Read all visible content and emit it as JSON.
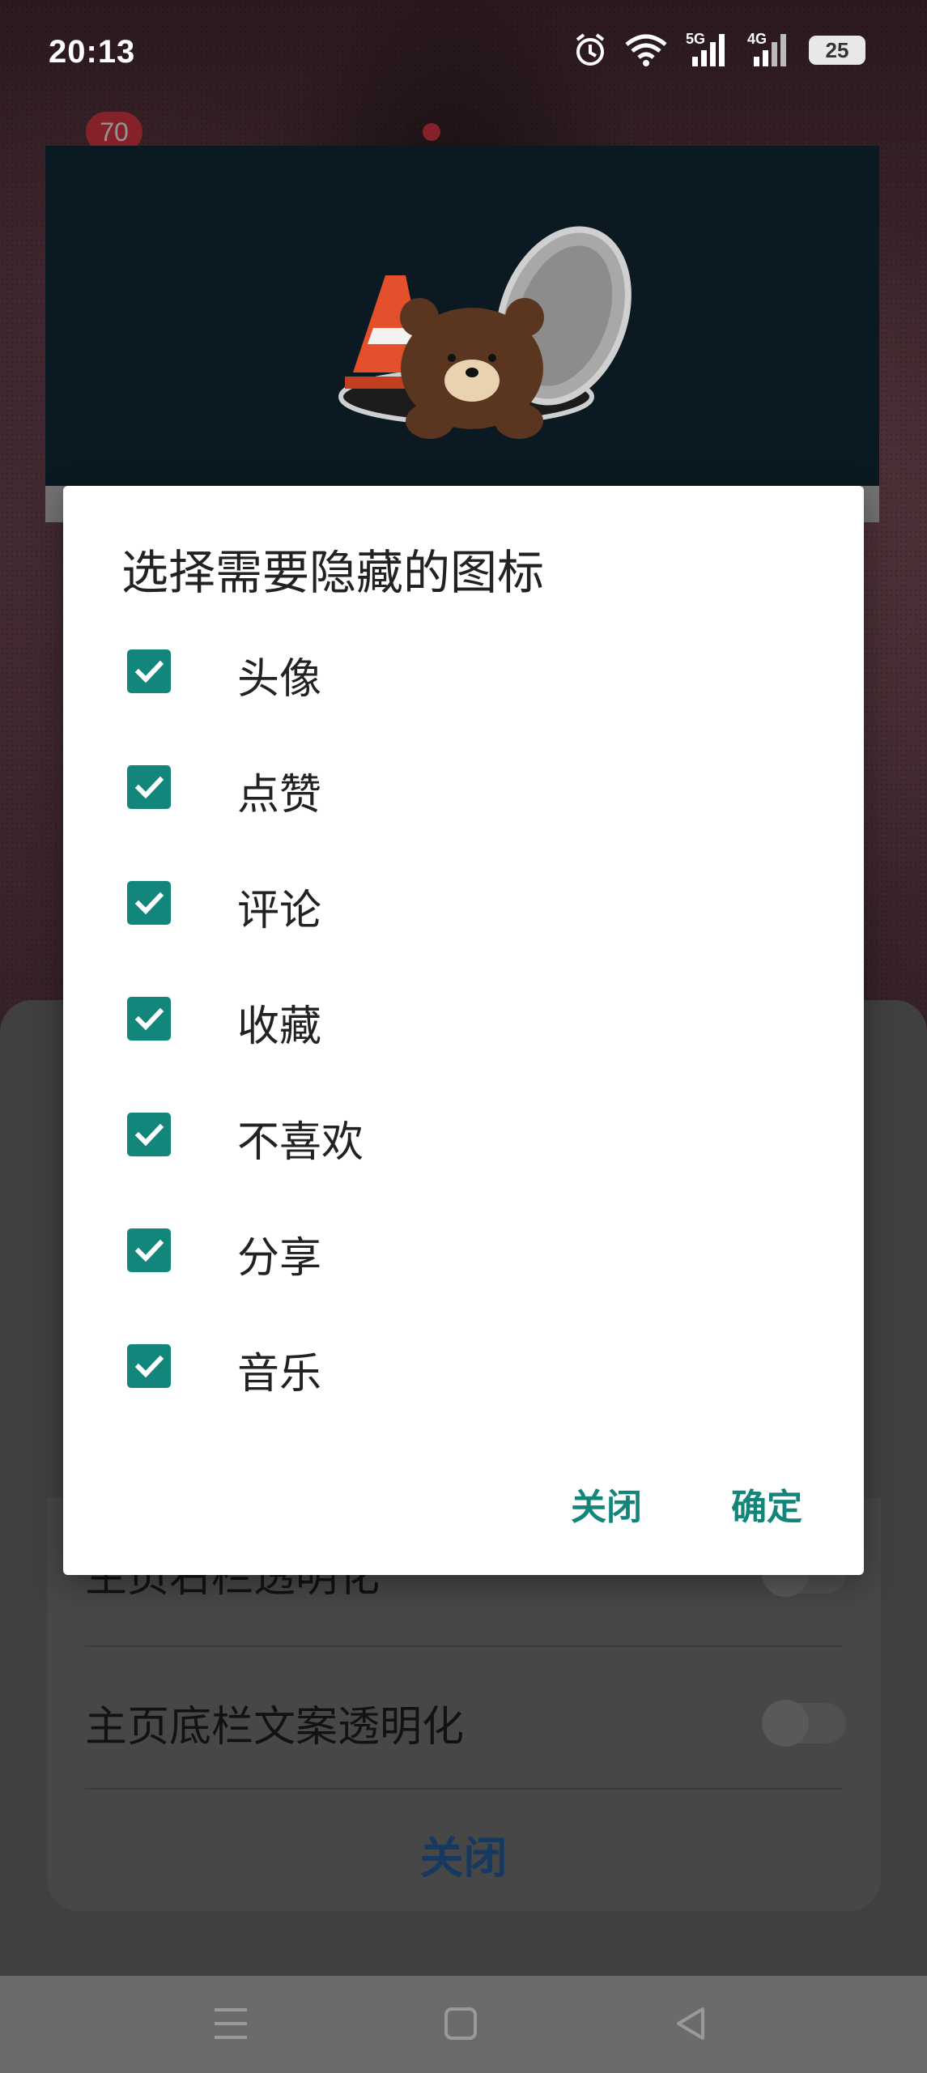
{
  "status_bar": {
    "time": "20:13",
    "network_1": "5G",
    "network_2": "4G",
    "battery": "25"
  },
  "background_app": {
    "notification_badge": "70",
    "settings": [
      {
        "label": "主页右栏透明化",
        "enabled": false
      },
      {
        "label": "主页底栏文案透明化",
        "enabled": false
      }
    ],
    "close_label": "关闭"
  },
  "dialog": {
    "title": "选择需要隐藏的图标",
    "options": [
      {
        "label": "头像",
        "checked": true
      },
      {
        "label": "点赞",
        "checked": true
      },
      {
        "label": "评论",
        "checked": true
      },
      {
        "label": "收藏",
        "checked": true
      },
      {
        "label": "不喜欢",
        "checked": true
      },
      {
        "label": "分享",
        "checked": true
      },
      {
        "label": "音乐",
        "checked": true
      }
    ],
    "close_button": "关闭",
    "confirm_button": "确定"
  },
  "colors": {
    "accent": "#12867a",
    "badge": "#e33a48",
    "link_blue": "#2563a6"
  },
  "icons": [
    "alarm-icon",
    "wifi-icon",
    "signal-icon",
    "battery-icon",
    "menu-icon",
    "home-icon",
    "back-icon",
    "checkmark-icon"
  ]
}
